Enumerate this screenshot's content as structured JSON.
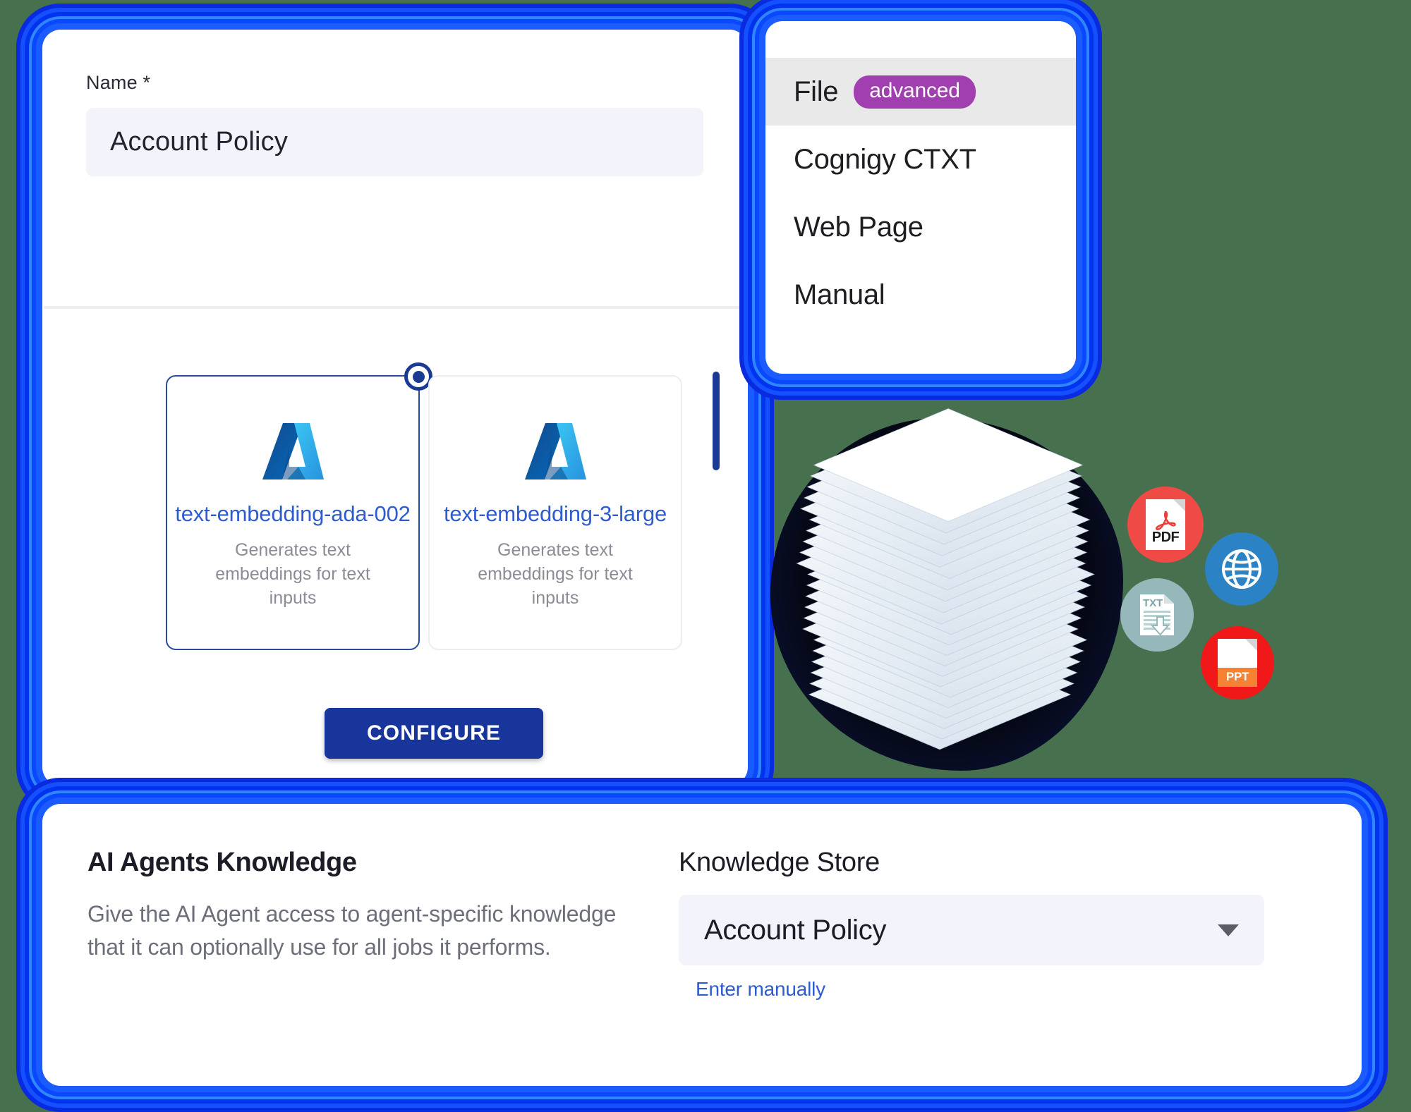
{
  "name_panel": {
    "field_label": "Name *",
    "name_value": "Account Policy",
    "configure_label": "CONFIGURE",
    "models": [
      {
        "title": "text-embedding-ada-002",
        "description": "Generates text embeddings for text inputs",
        "provider_icon": "azure-logo-icon",
        "selected": true
      },
      {
        "title": "text-embedding-3-large",
        "description": "Generates text embeddings for text inputs",
        "provider_icon": "azure-logo-icon",
        "selected": false
      }
    ]
  },
  "source_menu": {
    "items": [
      {
        "label": "File",
        "badge": "advanced",
        "active": true
      },
      {
        "label": "Cognigy CTXT",
        "badge": "",
        "active": false
      },
      {
        "label": "Web Page",
        "badge": "",
        "active": false
      },
      {
        "label": "Manual",
        "badge": "",
        "active": false
      }
    ]
  },
  "knowledge_panel": {
    "heading": "AI Agents Knowledge",
    "body": "Give the AI Agent access to agent-specific knowledge that it can optionally use for all jobs it performs.",
    "store_label": "Knowledge Store",
    "store_value": "Account Policy",
    "manual_link": "Enter manually"
  },
  "file_badges": [
    {
      "icon": "pdf-file-icon",
      "label": "PDF"
    },
    {
      "icon": "globe-web-icon",
      "label": ""
    },
    {
      "icon": "txt-download-icon",
      "label": "TXT"
    },
    {
      "icon": "ppt-file-icon",
      "label": "PPT"
    }
  ],
  "colors": {
    "glow_blue": "#0a48ff",
    "accent_navy": "#17359a",
    "badge_purple": "#a23fb0",
    "link_blue": "#2f5bd0",
    "input_bg": "#f3f4fb",
    "background": "#47704e"
  }
}
